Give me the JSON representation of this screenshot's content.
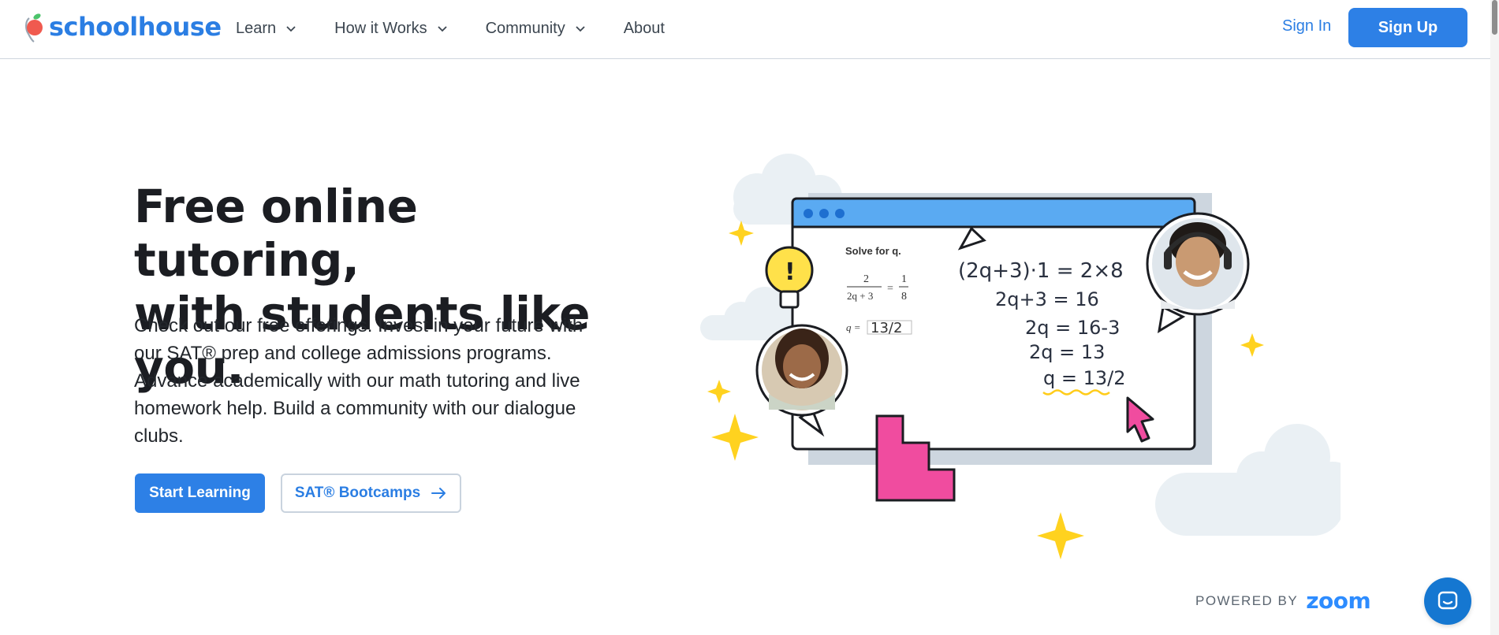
{
  "brand": {
    "name": "schoolhouse",
    "color": "#2b7ee3"
  },
  "nav": {
    "items": [
      {
        "label": "Learn",
        "has_dropdown": true
      },
      {
        "label": "How it Works",
        "has_dropdown": true
      },
      {
        "label": "Community",
        "has_dropdown": true
      },
      {
        "label": "About",
        "has_dropdown": false
      }
    ],
    "sign_in": "Sign In",
    "sign_up": "Sign Up"
  },
  "hero": {
    "headline_line1": "Free online tutoring,",
    "headline_line2": "with students like you.",
    "body": "Check out our free offerings. Invest in your future with our SAT® prep and college admissions programs. Advance academically with our math tutoring and live homework help. Build a community with our dialogue clubs.",
    "primary_cta": "Start Learning",
    "secondary_cta": "SAT® Bootcamps",
    "secondary_cta_icon": "arrow-right-icon"
  },
  "illustration": {
    "problem_title": "Solve for q.",
    "fraction_left_num": "2",
    "fraction_left_den": "2q + 3",
    "fraction_right_num": "1",
    "fraction_right_den": "8",
    "answer_prefix": "q =",
    "answer_value": "13/2",
    "work_lines": [
      "(2q+3)·1 = 2×8",
      "2q+3 = 16",
      "2q = 16-3",
      "2q = 13",
      "q = 13/2"
    ],
    "bulb_mark": "!"
  },
  "footer": {
    "powered_by": "POWERED BY",
    "zoom": "zoom",
    "chat_icon": "chat-icon"
  },
  "colors": {
    "accent": "#2d80e6",
    "browser_bar": "#5aaaf2",
    "pink": "#f04c9f",
    "star": "#ffd21f",
    "cloud": "#eaf0f4"
  }
}
